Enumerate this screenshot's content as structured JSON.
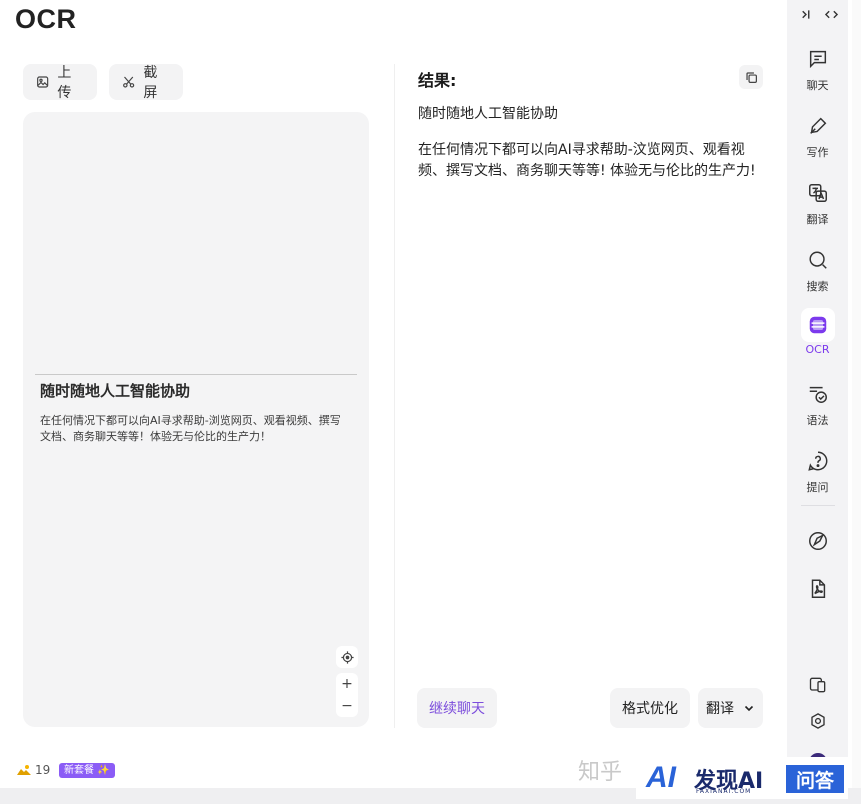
{
  "app": {
    "title": "OCR"
  },
  "toolbar": {
    "upload_label": "上传",
    "capture_label": "截屏"
  },
  "preview": {
    "doc_title": "随时随地人工智能协助",
    "doc_body": "在任何情况下都可以向AI寻求帮助-浏览网页、观看视频、撰写文档、商务聊天等等！体验无与伦比的生产力！",
    "locate_icon": "crosshair-icon",
    "zoom_in": "+",
    "zoom_out": "−"
  },
  "result": {
    "heading": "结果:",
    "line1": "随时随地人工智能协助",
    "line2": "在任何情况下都可以向AI寻求帮助-汶览网页、观看视频、撰写文档、商务聊天等等! 体验无与伦比的生产力!"
  },
  "actions": {
    "continue_label": "继续聊天",
    "format_label": "格式优化",
    "translate_label": "翻译"
  },
  "sidebar": {
    "top_icons": [
      "collapse-icon",
      "code-icon"
    ],
    "items": [
      {
        "label": "聊天",
        "icon": "chat-icon"
      },
      {
        "label": "写作",
        "icon": "pen-icon"
      },
      {
        "label": "翻译",
        "icon": "translate-icon"
      },
      {
        "label": "搜索",
        "icon": "search-icon"
      },
      {
        "label": "OCR",
        "icon": "ocr-icon",
        "active": true
      },
      {
        "label": "语法",
        "icon": "grammar-icon"
      },
      {
        "label": "提问",
        "icon": "question-icon"
      }
    ],
    "accent": "#7c3aed"
  },
  "footer": {
    "credits": "19",
    "plan_badge": "新套餐 ✨",
    "watermark_zhihu": "知乎",
    "watermark_ai": "AI",
    "watermark_text": "发现AI",
    "watermark_sub": "FAXIANAI.COM",
    "watermark_ask": "问答"
  }
}
